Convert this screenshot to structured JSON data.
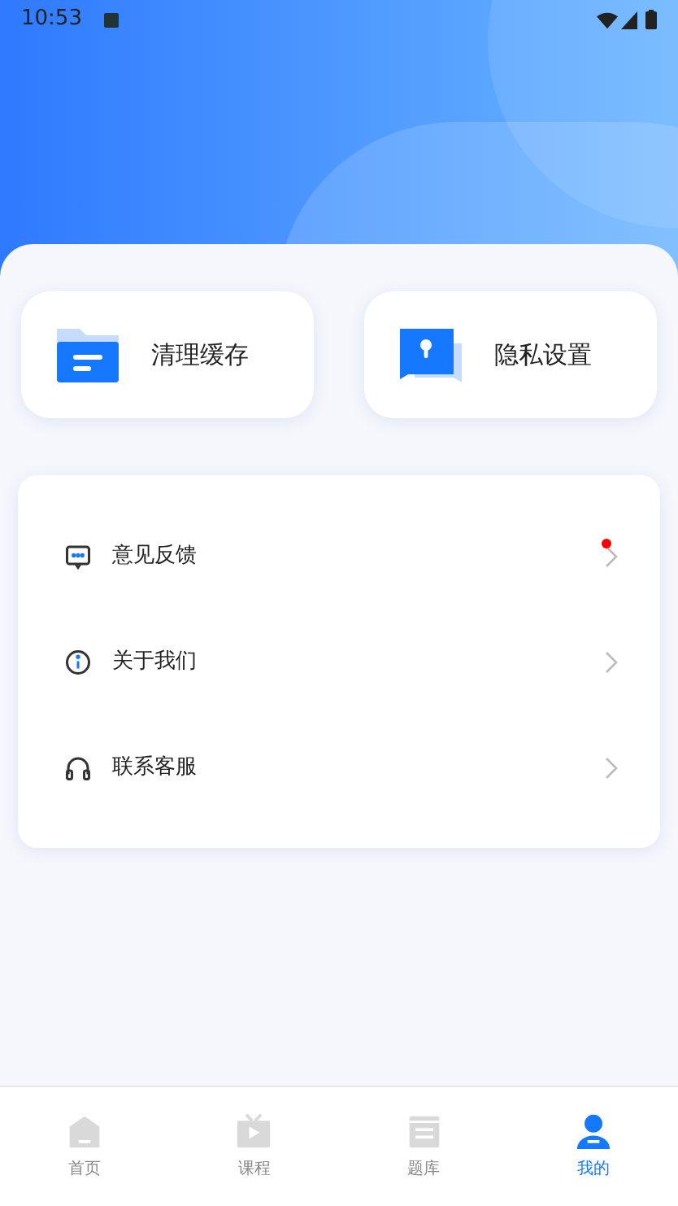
{
  "status_bar": {
    "time": "10:53"
  },
  "quick_actions": [
    {
      "kind": "folder",
      "label": "清理缓存"
    },
    {
      "kind": "privacy",
      "label": "隐私设置"
    }
  ],
  "menu": [
    {
      "kind": "feedback",
      "label": "意见反馈",
      "badge": true
    },
    {
      "kind": "about",
      "label": "关于我们",
      "badge": false
    },
    {
      "kind": "support",
      "label": "联系客服",
      "badge": false
    }
  ],
  "tabs": [
    {
      "kind": "home",
      "label": "首页",
      "selected": false
    },
    {
      "kind": "course",
      "label": "课程",
      "selected": false
    },
    {
      "kind": "bank",
      "label": "题库",
      "selected": false
    },
    {
      "kind": "me",
      "label": "我的",
      "selected": true
    }
  ]
}
